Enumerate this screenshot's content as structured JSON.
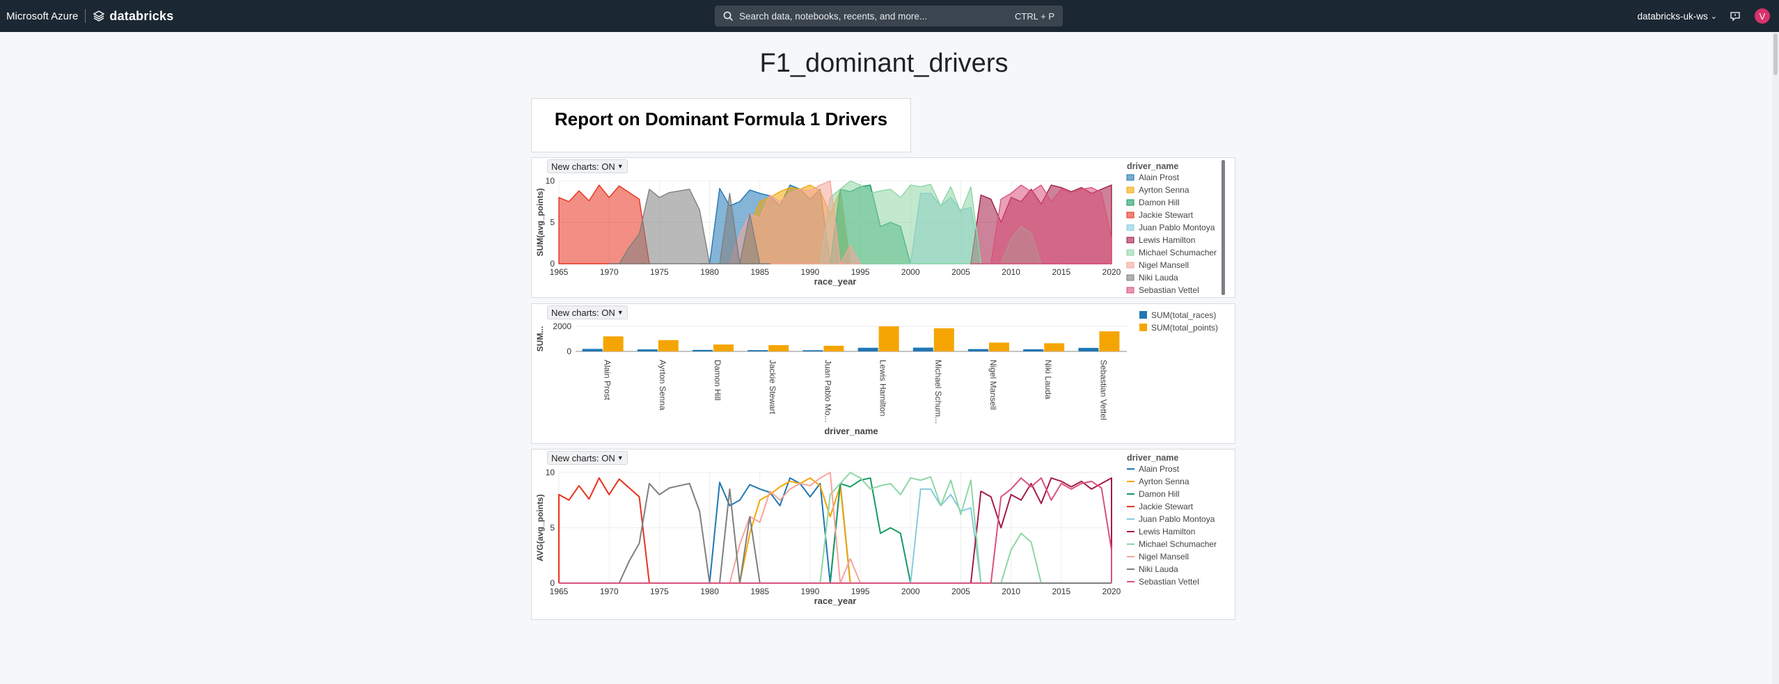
{
  "topbar": {
    "azure": "Microsoft Azure",
    "brand": "databricks",
    "search_placeholder": "Search data, notebooks, recents, and more...",
    "search_shortcut": "CTRL + P",
    "workspace": "databricks-uk-ws",
    "avatar_initial": "V"
  },
  "dashboard": {
    "title": "F1_dominant_drivers",
    "text_widget": "Report on Dominant Formula 1 Drivers",
    "toggle_label": "New charts: ON"
  },
  "colors": {
    "Alain Prost": "#1f77b4",
    "Ayrton Senna": "#f5a503",
    "Damon Hill": "#179b62",
    "Jackie Stewart": "#e8321e",
    "Juan Pablo Montoya": "#86cbe0",
    "Lewis Hamilton": "#a31c44",
    "Michael Schumacher": "#8fd6a6",
    "Nigel Mansell": "#f5a59a",
    "Niki Lauda": "#7f7f7f",
    "Sebastian Vettel": "#d8527c"
  },
  "chart_data": [
    {
      "type": "area",
      "xlabel": "race_year",
      "ylabel": "SUM(avg_points)",
      "legend_title": "driver_name",
      "xlim": [
        1965,
        2020
      ],
      "ylim": [
        0,
        10
      ],
      "x_ticks": [
        1965,
        1970,
        1975,
        1980,
        1985,
        1990,
        1995,
        2000,
        2005,
        2010,
        2015,
        2020
      ],
      "y_ticks": [
        0,
        5,
        10
      ],
      "legend": [
        "Alain Prost",
        "Ayrton Senna",
        "Damon Hill",
        "Jackie Stewart",
        "Juan Pablo Montoya",
        "Lewis Hamilton",
        "Michael Schumacher",
        "Nigel Mansell",
        "Niki Lauda",
        "Sebastian Vettel"
      ]
    },
    {
      "type": "bar",
      "xlabel": "driver_name",
      "ylabel": "SUM...",
      "ylim": [
        0,
        2000
      ],
      "y_ticks": [
        0,
        2000
      ],
      "categories": [
        "Alain Prost",
        "Ayrton Senna",
        "Damon Hill",
        "Jackie Stewart",
        "Juan Pablo Mo...",
        "Lewis Hamilton",
        "Michael Schum...",
        "Nigel Mansell",
        "Niki Lauda",
        "Sebastian Vettel"
      ],
      "series": [
        {
          "name": "SUM(total_races)",
          "color": "#1f77b4",
          "values": [
            200,
            160,
            120,
            100,
            95,
            290,
            300,
            185,
            170,
            280
          ]
        },
        {
          "name": "SUM(total_points)",
          "color": "#f5a503",
          "values": [
            1200,
            900,
            550,
            500,
            450,
            2000,
            1850,
            700,
            650,
            1600
          ]
        }
      ]
    },
    {
      "type": "line",
      "xlabel": "race_year",
      "ylabel": "AVG(avg_points)",
      "legend_title": "driver_name",
      "xlim": [
        1965,
        2020
      ],
      "ylim": [
        0,
        10
      ],
      "x_ticks": [
        1965,
        1970,
        1975,
        1980,
        1985,
        1990,
        1995,
        2000,
        2005,
        2010,
        2015,
        2020
      ],
      "y_ticks": [
        0,
        5,
        10
      ],
      "legend": [
        "Alain Prost",
        "Ayrton Senna",
        "Damon Hill",
        "Jackie Stewart",
        "Juan Pablo Montoya",
        "Lewis Hamilton",
        "Michael Schumacher",
        "Nigel Mansell",
        "Niki Lauda",
        "Sebastian Vettel"
      ]
    }
  ],
  "series_data": {
    "Jackie Stewart": {
      "x": [
        1965,
        1966,
        1967,
        1968,
        1969,
        1970,
        1971,
        1972,
        1973,
        1974
      ],
      "y": [
        8,
        7.5,
        8.8,
        7.6,
        9.5,
        8,
        9.4,
        8.6,
        7.8,
        0
      ]
    },
    "Niki Lauda": {
      "x": [
        1970,
        1971,
        1972,
        1973,
        1974,
        1975,
        1976,
        1977,
        1978,
        1979,
        1980,
        1981,
        1982,
        1983,
        1984,
        1985,
        1986
      ],
      "y": [
        0,
        0,
        2,
        3.6,
        9,
        8,
        8.6,
        8.8,
        9,
        6.5,
        0,
        0,
        8.5,
        0,
        6,
        0,
        0
      ]
    },
    "Alain Prost": {
      "x": [
        1979,
        1980,
        1981,
        1982,
        1983,
        1984,
        1985,
        1986,
        1987,
        1988,
        1989,
        1990,
        1991,
        1992,
        1993,
        1994
      ],
      "y": [
        0,
        0,
        9.1,
        7,
        7.5,
        8.9,
        8.5,
        8.2,
        7,
        9.5,
        9,
        7.8,
        9,
        0,
        9,
        0
      ]
    },
    "Nigel Mansell": {
      "x": [
        1980,
        1981,
        1982,
        1983,
        1984,
        1985,
        1986,
        1987,
        1988,
        1989,
        1990,
        1991,
        1992,
        1993,
        1994,
        1995
      ],
      "y": [
        0,
        0,
        0,
        3.5,
        6,
        5.5,
        8.3,
        7.5,
        8.5,
        9,
        8.8,
        9.5,
        10,
        0,
        2.2,
        0
      ]
    },
    "Ayrton Senna": {
      "x": [
        1983,
        1984,
        1985,
        1986,
        1987,
        1988,
        1989,
        1990,
        1991,
        1992,
        1993,
        1994
      ],
      "y": [
        0,
        4.5,
        7.5,
        8,
        8.7,
        9.2,
        9,
        9.5,
        8.8,
        6,
        8.8,
        0
      ]
    },
    "Michael Schumacher": {
      "x": [
        1990,
        1991,
        1992,
        1993,
        1994,
        1995,
        1996,
        1997,
        1998,
        1999,
        2000,
        2001,
        2002,
        2003,
        2004,
        2005,
        2006,
        2007,
        2008,
        2009,
        2010,
        2011,
        2012,
        2013
      ],
      "y": [
        0,
        0,
        8,
        9,
        10,
        9.5,
        8.5,
        8.8,
        9,
        8,
        9.5,
        9.3,
        9.6,
        7,
        9.3,
        6.2,
        9.3,
        0,
        0,
        0,
        3,
        4.5,
        3.7,
        0
      ]
    },
    "Damon Hill": {
      "x": [
        1991,
        1992,
        1993,
        1994,
        1995,
        1996,
        1997,
        1998,
        1999,
        2000
      ],
      "y": [
        0,
        0,
        9,
        8.7,
        9.3,
        9.5,
        4.5,
        5,
        4.5,
        0
      ]
    },
    "Juan Pablo Montoya": {
      "x": [
        2000,
        2001,
        2002,
        2003,
        2004,
        2005,
        2006,
        2007
      ],
      "y": [
        0,
        8.5,
        8.5,
        7,
        8,
        6.5,
        6.8,
        0
      ]
    },
    "Lewis Hamilton": {
      "x": [
        2006,
        2007,
        2008,
        2009,
        2010,
        2011,
        2012,
        2013,
        2014,
        2015,
        2016,
        2017,
        2018,
        2019,
        2020
      ],
      "y": [
        0,
        8.3,
        7.8,
        5,
        8,
        7.5,
        9,
        7.2,
        9.5,
        9.2,
        8.7,
        9.2,
        8.5,
        9,
        9.5
      ]
    },
    "Sebastian Vettel": {
      "x": [
        2006,
        2007,
        2008,
        2009,
        2010,
        2011,
        2012,
        2013,
        2014,
        2015,
        2016,
        2017,
        2018,
        2019,
        2020
      ],
      "y": [
        0,
        0,
        0,
        7.8,
        8.5,
        9.5,
        8.7,
        9.5,
        7.5,
        9,
        8.5,
        9,
        9.2,
        8.6,
        3
      ]
    }
  }
}
